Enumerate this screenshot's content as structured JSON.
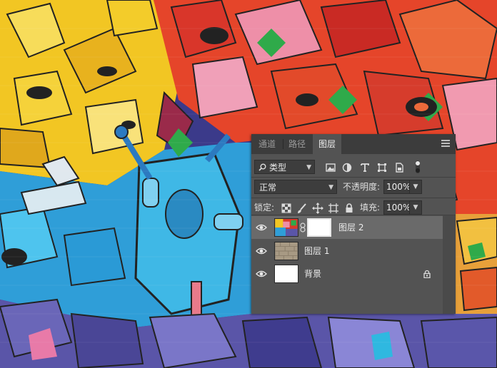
{
  "panel": {
    "tabs": [
      {
        "label": "通道",
        "active": false
      },
      {
        "label": "路径",
        "active": false
      },
      {
        "label": "图层",
        "active": true
      }
    ],
    "filter": {
      "label": "类型",
      "icon": "search-icon"
    },
    "filter_icons": [
      "image-filter-icon",
      "adjustment-filter-icon",
      "type-filter-icon",
      "shape-filter-icon",
      "smart-object-filter-icon",
      "filter-toggle-icon"
    ],
    "blend_mode": "正常",
    "opacity": {
      "label": "不透明度:",
      "value": "100%"
    },
    "lock": {
      "label": "锁定:",
      "icons": [
        "lock-transparent-icon",
        "lock-paint-icon",
        "lock-move-icon",
        "lock-artboard-icon",
        "lock-all-icon"
      ]
    },
    "fill": {
      "label": "填充:",
      "value": "100%"
    },
    "layers": [
      {
        "name": "图层 2",
        "visible": true,
        "selected": true,
        "has_mask": true
      },
      {
        "name": "图层 1",
        "visible": true,
        "selected": false,
        "has_mask": false
      },
      {
        "name": "背景",
        "visible": true,
        "selected": false,
        "locked": true
      }
    ]
  },
  "colors": {
    "panel_bg": "#535353",
    "tab_bar_bg": "#3c3c3c",
    "selected_layer_bg": "#6a6a6a"
  }
}
